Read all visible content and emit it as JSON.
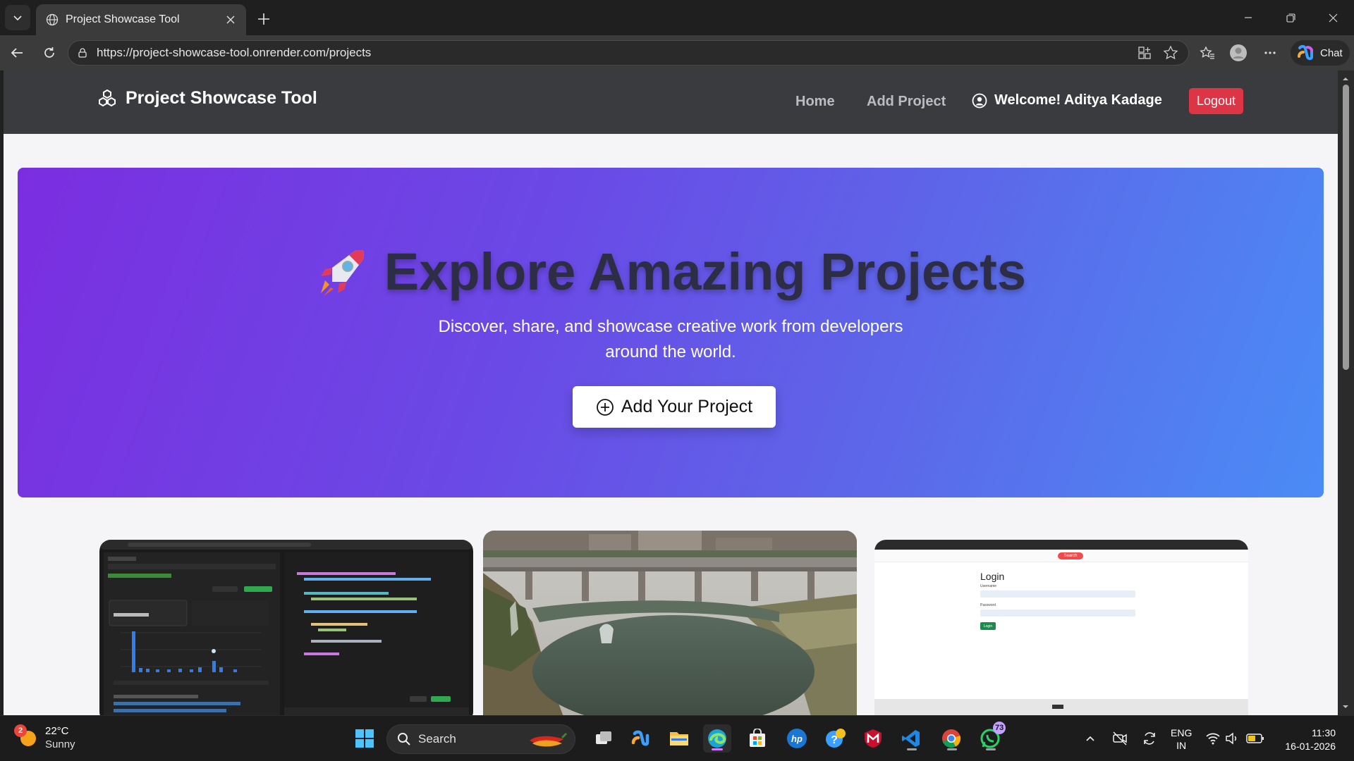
{
  "browser": {
    "tab_title": "Project Showcase Tool",
    "url": "https://project-showcase-tool.onrender.com/projects",
    "copilot_label": "Chat"
  },
  "site": {
    "brand": "Project Showcase Tool",
    "nav": {
      "home": "Home",
      "add_project": "Add Project"
    },
    "welcome": "Welcome! Aditya Kadage",
    "logout": "Logout"
  },
  "hero": {
    "title": "Explore Amazing Projects",
    "subtitle": "Discover, share, and showcase creative work from developers around the world.",
    "button": "Add Your Project"
  },
  "cards": [
    {
      "kind": "screenshot-code-editor"
    },
    {
      "kind": "photo-river-bridge"
    },
    {
      "kind": "screenshot-login",
      "login_title": "Login",
      "username_label": "Username",
      "password_label": "Password",
      "login_button": "Login",
      "search_button": "Search"
    }
  ],
  "taskbar": {
    "weather": {
      "temp": "22°C",
      "condition": "Sunny",
      "badge": "2"
    },
    "search_label": "Search",
    "whatsapp_badge": "73",
    "lang_line1": "ENG",
    "lang_line2": "IN",
    "time": "11:30",
    "date": "16-01-2026"
  }
}
